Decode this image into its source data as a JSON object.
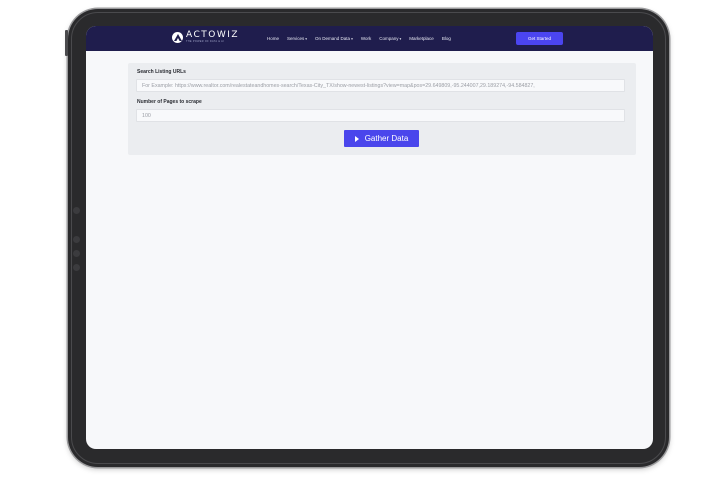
{
  "brand": {
    "name": "ACTOWIZ",
    "tagline": "THE POWER OF DATA & AI",
    "colors": {
      "nav": "#1f1d4d",
      "accent": "#4b45f0"
    }
  },
  "nav": {
    "items": [
      {
        "label": "Home",
        "caret": false
      },
      {
        "label": "Services",
        "caret": true
      },
      {
        "label": "On Demand Data",
        "caret": true
      },
      {
        "label": "Work",
        "caret": false
      },
      {
        "label": "Company",
        "caret": true
      },
      {
        "label": "Marketplace",
        "caret": false
      },
      {
        "label": "Blog",
        "caret": false
      }
    ],
    "cta_label": "Get Started",
    "caret_icon": "chevron-down-icon"
  },
  "form": {
    "urls_label": "Search Listing URLs",
    "urls_placeholder": "For Example: https://www.realtor.com/realestateandhomes-search/Texas-City_TX/show-newest-listings?view=map&pos=29.649809,-95.244007,29.189274,-94.584827,",
    "pages_label": "Number of Pages to scrape",
    "pages_value": "100",
    "submit_label": "Gather Data",
    "submit_icon": "play-icon"
  }
}
